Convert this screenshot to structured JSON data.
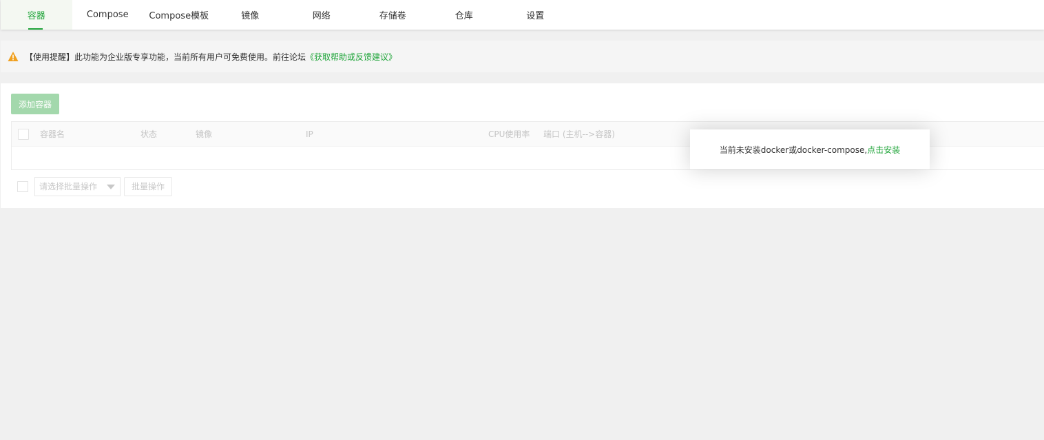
{
  "tabs": [
    {
      "label": "容器",
      "active": true
    },
    {
      "label": "Compose"
    },
    {
      "label": "Compose模板"
    },
    {
      "label": "镜像"
    },
    {
      "label": "网络"
    },
    {
      "label": "存储卷"
    },
    {
      "label": "仓库"
    },
    {
      "label": "设置"
    }
  ],
  "alert": {
    "icon": "warning-icon",
    "text": "【使用提醒】此功能为企业版专享功能，当前所有用户可免费使用。前往论坛",
    "link": "《获取帮助或反馈建议》"
  },
  "toolbar": {
    "add_button": "添加容器"
  },
  "table": {
    "columns": [
      "容器名",
      "状态",
      "镜像",
      "IP",
      "CPU使用率",
      "端口 (主机-->容器)"
    ]
  },
  "batch": {
    "select_placeholder": "请选择批量操作",
    "button": "批量操作"
  },
  "toast": {
    "message": "当前未安装docker或docker-compose,",
    "link": "点击安装"
  },
  "colors": {
    "accent": "#20a53a",
    "warning": "#f0a020"
  }
}
